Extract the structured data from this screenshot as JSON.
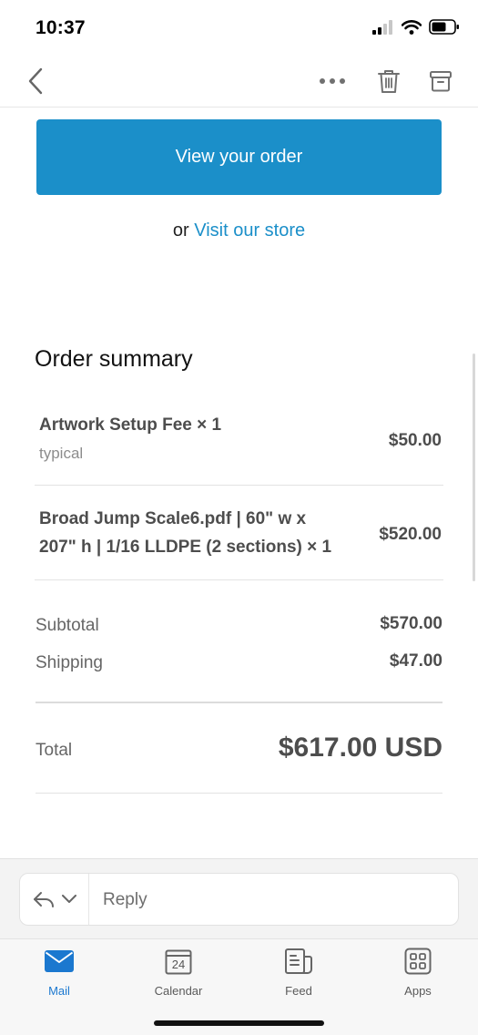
{
  "status_bar": {
    "time": "10:37"
  },
  "email": {
    "view_order_label": "View your order",
    "store_prefix": "or",
    "store_link": "Visit our store",
    "summary_title": "Order summary",
    "items": [
      {
        "name": "Artwork Setup Fee × 1",
        "variant": "typical",
        "price": "$50.00"
      },
      {
        "name_line1": "Broad Jump Scale6.pdf | 60\" w x",
        "name_line2": "207\" h | 1/16 LLDPE (2 sections) × 1",
        "price": "$520.00"
      }
    ],
    "subtotal_label": "Subtotal",
    "subtotal_value": "$570.00",
    "shipping_label": "Shipping",
    "shipping_value": "$47.00",
    "total_label": "Total",
    "total_value": "$617.00 USD"
  },
  "reply": {
    "placeholder": "Reply"
  },
  "tabs": [
    {
      "label": "Mail",
      "active": true
    },
    {
      "label": "Calendar",
      "date": "24"
    },
    {
      "label": "Feed"
    },
    {
      "label": "Apps"
    }
  ],
  "colors": {
    "accent": "#1b8fc9",
    "tab_active": "#1b78cf"
  }
}
